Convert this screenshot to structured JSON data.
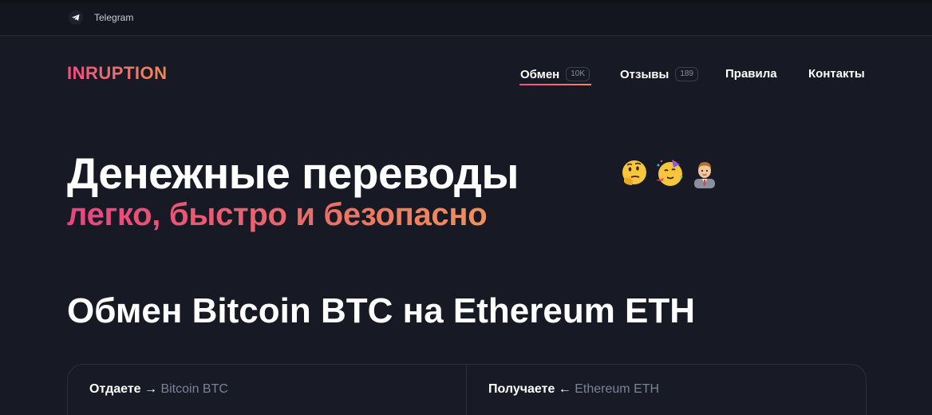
{
  "topbar": {
    "telegram_label": "Telegram"
  },
  "header": {
    "logo": "INRUPTION",
    "nav": [
      {
        "label": "Обмен",
        "badge": "10K"
      },
      {
        "label": "Отзывы",
        "badge": "189"
      },
      {
        "label": "Правила"
      },
      {
        "label": "Контакты"
      }
    ],
    "active_nav": "Обмен"
  },
  "hero": {
    "title": "Денежные переводы",
    "subtitle": "легко, быстро и безопасно",
    "emojis": [
      "thinking-face-icon",
      "partying-face-icon",
      "office-worker-icon"
    ]
  },
  "exchange": {
    "title": "Обмен Bitcoin BTC на Ethereum ETH",
    "give": {
      "label": "Отдаете",
      "arrow": "→",
      "coin": "Bitcoin BTC"
    },
    "receive": {
      "label": "Получаете",
      "arrow": "←",
      "coin": "Ethereum ETH"
    }
  },
  "colors": {
    "background": "#171a24",
    "accent_start": "#f0507e",
    "accent_end": "#f08a5a",
    "muted": "#7c8296"
  }
}
